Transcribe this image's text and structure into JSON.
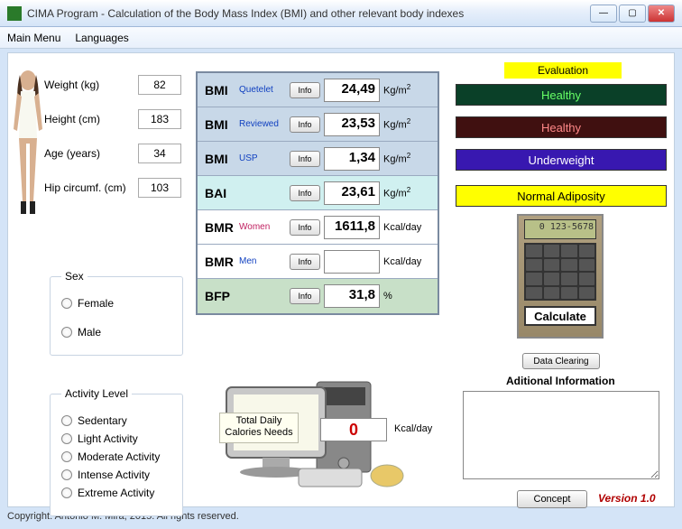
{
  "window": {
    "title": "CIMA Program - Calculation of the Body Mass Index (BMI) and other relevant body indexes"
  },
  "menu": {
    "main": "Main Menu",
    "lang": "Languages"
  },
  "inputs": {
    "weight_lab": "Weight (kg)",
    "weight_val": "82",
    "height_lab": "Height (cm)",
    "height_val": "183",
    "age_lab": "Age (years)",
    "age_val": "34",
    "hip_lab": "Hip circumf. (cm)",
    "hip_val": "103"
  },
  "sex": {
    "legend": "Sex",
    "female": "Female",
    "male": "Male"
  },
  "activity": {
    "legend": "Activity Level",
    "opts": [
      "Sedentary",
      "Light Activity",
      "Moderate Activity",
      "Intense Activity",
      "Extreme Activity"
    ]
  },
  "calc": {
    "info": "Info",
    "rows": [
      {
        "lab": "BMI",
        "sub": "Quetelet",
        "val": "24,49",
        "unit": "Kg/m",
        "sup": "2"
      },
      {
        "lab": "BMI",
        "sub": "Reviewed",
        "val": "23,53",
        "unit": "Kg/m",
        "sup": "2"
      },
      {
        "lab": "BMI",
        "sub": "USP",
        "val": "1,34",
        "unit": "Kg/m",
        "sup": "2"
      },
      {
        "lab": "BAI",
        "sub": "",
        "val": "23,61",
        "unit": "Kg/m",
        "sup": "2"
      },
      {
        "lab": "BMR",
        "sub": "Women",
        "val": "1611,8",
        "unit": "Kcal/day",
        "sup": ""
      },
      {
        "lab": "BMR",
        "sub": "Men",
        "val": "",
        "unit": "Kcal/day",
        "sup": ""
      },
      {
        "lab": "BFP",
        "sub": "",
        "val": "31,8",
        "unit": "%",
        "sup": ""
      }
    ]
  },
  "tcal": {
    "label": "Total Daily Calories Needs",
    "value": "0",
    "unit": "Kcal/day"
  },
  "eval": {
    "head": "Evaluation",
    "e1": "Healthy",
    "e2": "Healthy",
    "e3": "Underweight",
    "e4": "Normal Adiposity"
  },
  "calc_img": {
    "display": "0 123-5678",
    "button": "Calculate"
  },
  "buttons": {
    "data_clear": "Data Clearing",
    "concept": "Concept"
  },
  "add_info": "Aditional Information",
  "version": "Version 1.0",
  "copyright": "Copyright: Antonio M. Mira, 2015. All rights reserved."
}
